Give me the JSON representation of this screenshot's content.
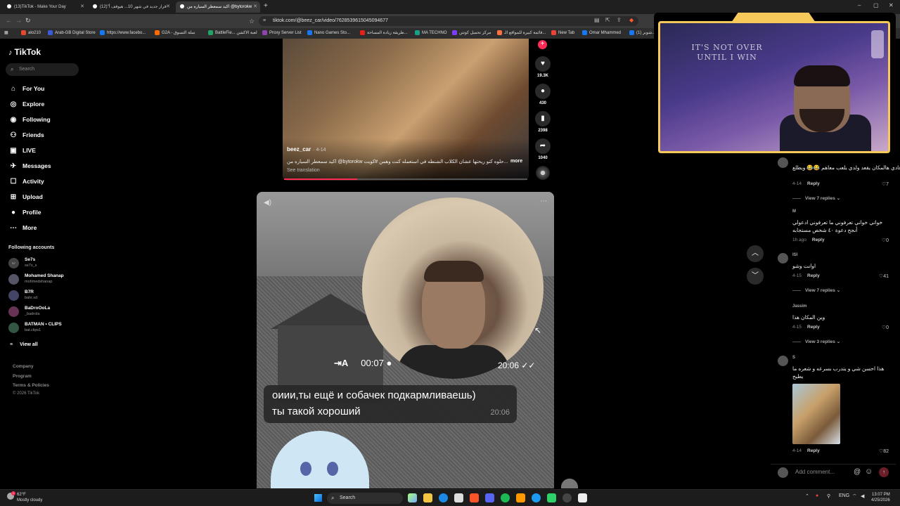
{
  "browser": {
    "tabs": [
      {
        "label": "(13)TikTok - Make Your Day",
        "active": false
      },
      {
        "label": "(12)\"قرار جديد في شهر 10... هيوقف أ",
        "active": false
      },
      {
        "label": "اكيد سمعطر السياره من @bytorokw",
        "active": true
      }
    ],
    "new_tab": "+",
    "url": "tiktok.com/@beez_car/video/7628539615045094677",
    "window_controls": {
      "minimize": "–",
      "maximize": "▢",
      "close": "✕"
    },
    "bookmarks": [
      {
        "label": "alo210",
        "color": "#e5482d"
      },
      {
        "label": "Arab-GB Digital Store",
        "color": "#3b5bdb"
      },
      {
        "label": "https://www.facebo...",
        "color": "#1877f2"
      },
      {
        "label": "G2A - سلة التسوق",
        "color": "#ff6a00"
      },
      {
        "label": "BattleFie... لعبة الاكشن",
        "color": "#21a366"
      },
      {
        "label": "Proxy Server List",
        "color": "#8e44ad"
      },
      {
        "label": "Nano Games Sto...",
        "color": "#1877f2"
      },
      {
        "label": "طريقة زيادة المساحة...",
        "color": "#e62117"
      },
      {
        "label": "MA TECHNO",
        "color": "#16a085"
      },
      {
        "label": "مركز تحميل كوتنن",
        "color": "#7d3cff"
      },
      {
        "label": "قائمة كبيرة للمواقع الـ...",
        "color": "#ff7043"
      },
      {
        "label": "New Tab",
        "color": "#ea4335"
      },
      {
        "label": "Omar Mhammed",
        "color": "#1877f2"
      },
      {
        "label": "(1) شوبر...",
        "color": "#1877f2"
      }
    ]
  },
  "tiktok": {
    "logo": "TikTok",
    "search_placeholder": "Search",
    "nav": [
      {
        "label": "For You",
        "icon": "home-icon",
        "glyph": "⌂",
        "active": false
      },
      {
        "label": "Explore",
        "icon": "compass-icon",
        "glyph": "◎",
        "active": false
      },
      {
        "label": "Following",
        "icon": "following-icon",
        "glyph": "◉",
        "active": false
      },
      {
        "label": "Friends",
        "icon": "friends-icon",
        "glyph": "⚇",
        "active": false
      },
      {
        "label": "LIVE",
        "icon": "live-icon",
        "glyph": "▣",
        "active": false
      },
      {
        "label": "Messages",
        "icon": "messages-icon",
        "glyph": "✈",
        "active": false
      },
      {
        "label": "Activity",
        "icon": "activity-icon",
        "glyph": "☐",
        "active": false
      },
      {
        "label": "Upload",
        "icon": "upload-icon",
        "glyph": "⊞",
        "active": false
      },
      {
        "label": "Profile",
        "icon": "profile-icon",
        "glyph": "●",
        "active": false
      },
      {
        "label": "More",
        "icon": "more-icon",
        "glyph": "⋯",
        "active": false
      }
    ],
    "following_title": "Following accounts",
    "accounts": [
      {
        "name": "Se7s",
        "handle": "se7s_s"
      },
      {
        "name": "Mohamed Shanap",
        "handle": "mohmedshanap"
      },
      {
        "name": "B7R",
        "handle": "bahr.xd"
      },
      {
        "name": "BaDroOoLa",
        "handle": "_badrola"
      },
      {
        "name": "BATMAN • CLIPS",
        "handle": "bat.clips1"
      }
    ],
    "view_all": "View all",
    "footer": [
      "Company",
      "Program",
      "Terms & Policies"
    ],
    "copyright": "© 2026 TikTok"
  },
  "video1": {
    "author": "beez_car",
    "date": "· 4-14",
    "caption": "اكيد سمعطر السياره من @bytorokw حلوه كنو ريحتها عشان الكلاب الشنطه في استعمله كنت وهمن #كويت...",
    "more": "more",
    "see_translation": "See translation",
    "likes": "19.3K",
    "comments": "430",
    "saves": "2398",
    "shares": "1040"
  },
  "video2": {
    "forward_label": "⇥A",
    "duration": "00:07",
    "time": "20:06",
    "message_line1": "оиии,ты ещё и собачек подкармливаешь)",
    "message_line2": "ты такой хороший",
    "message_time": "20:06"
  },
  "webcam": {
    "quote_line1": "IT'S NOT OVER",
    "quote_line2": "UNTIL I WIN"
  },
  "comments": [
    {
      "user": "",
      "text": "عادي هالمكان يقعد ولدي يلعب معاهم 😂😂 ويطلع",
      "date": "4-14",
      "likes": "7",
      "replies": "View 7 replies"
    },
    {
      "user": "M",
      "text": "خواتي خواني تعرفوني ما تعرفوني ادعولي",
      "text2": "أنجح دعوة ٤٠ شخص مستجابه",
      "date": "1h ago",
      "likes": "0"
    },
    {
      "user": "ISI",
      "text": "اوانت وشو",
      "date": "4-15",
      "likes": "41",
      "replies": "View 7 replies"
    },
    {
      "user": "Jassim",
      "text": "وين المكان هذا",
      "date": "4-15",
      "likes": "0",
      "replies": "View 3 replies"
    },
    {
      "user": "S",
      "text": "هذا احسن شي و يتدرب بسرعه و شعره ما",
      "text2": "يطيح",
      "date": "4-14",
      "likes": "82"
    }
  ],
  "reply_label": "Reply",
  "add_comment_placeholder": "Add comment...",
  "taskbar": {
    "weather_temp": "62°F",
    "weather_desc": "Mostly cloudy",
    "search_label": "Search",
    "lang": "ENG",
    "time": "13:07 PM",
    "date": "4/25/2026"
  }
}
